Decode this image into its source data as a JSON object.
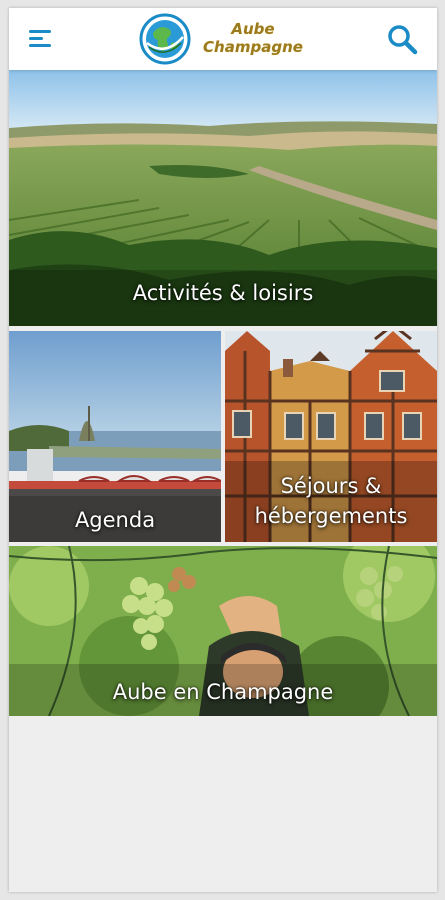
{
  "header": {
    "logo": {
      "line1": "Aube",
      "line2": "Champagne"
    },
    "menu_icon": "hamburger-menu-icon",
    "search_icon": "search-icon"
  },
  "tiles": [
    {
      "label": "Activités & loisirs",
      "scene": "vineyard-hills"
    },
    {
      "label": "Agenda",
      "scene": "lake-shore"
    },
    {
      "label": "Séjours &\nhébergements",
      "scene": "half-timbered-houses"
    },
    {
      "label": "Aube en Champagne",
      "scene": "grape-harvest"
    }
  ],
  "colors": {
    "accent": "#1a8bc7",
    "logo_gold": "#9b7b1f"
  }
}
